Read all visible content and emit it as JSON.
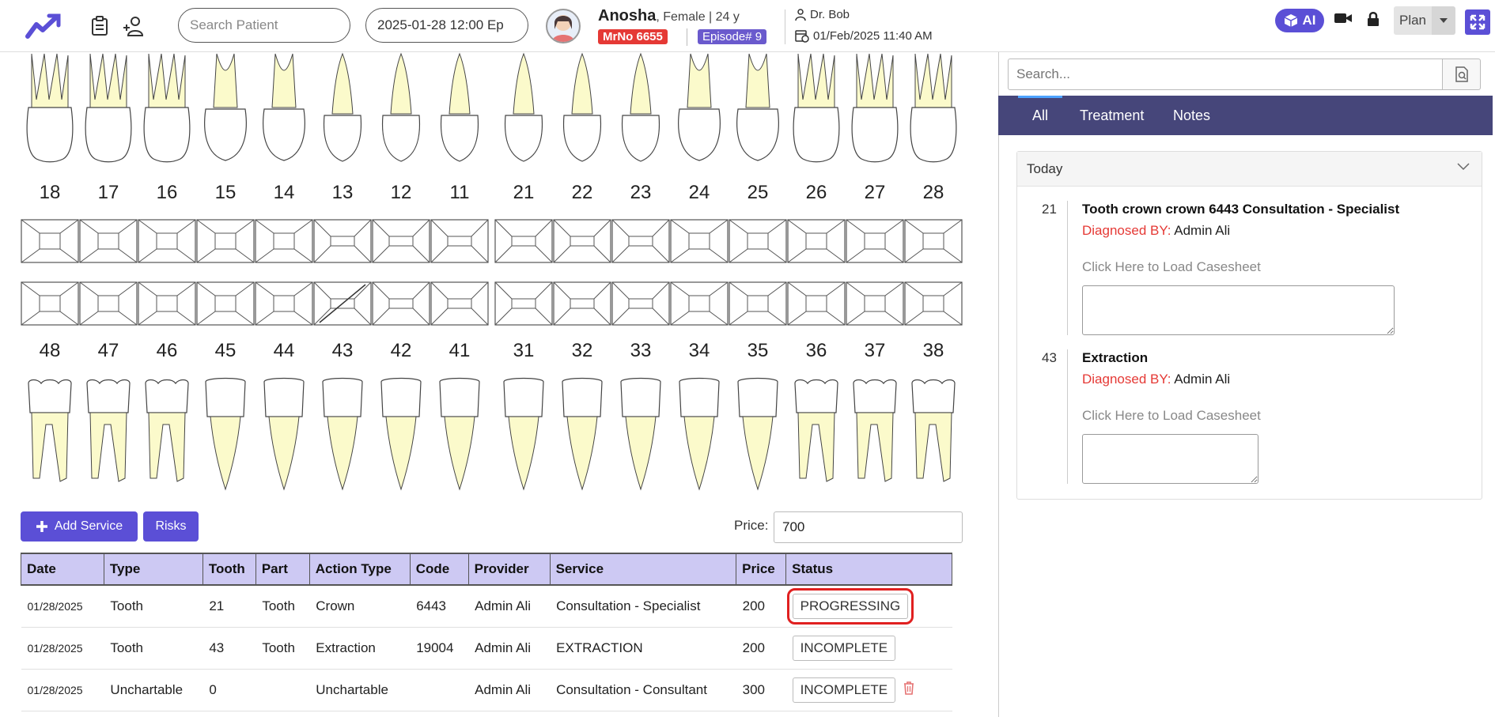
{
  "topbar": {
    "search_placeholder": "Search Patient",
    "episode_date": "2025-01-28 12:00 Ep",
    "patient_name": "Anosha",
    "patient_info": ", Female | 24 y",
    "mrno": "MrNo 6655",
    "episode": "Episode# 9",
    "doctor": "Dr. Bob",
    "datetime": "01/Feb/2025 11:40 AM",
    "ai_label": "AI",
    "plan_label": "Plan"
  },
  "chart": {
    "upper_numbers": [
      "18",
      "17",
      "16",
      "15",
      "14",
      "13",
      "12",
      "11",
      "21",
      "22",
      "23",
      "24",
      "25",
      "26",
      "27",
      "28"
    ],
    "lower_numbers": [
      "48",
      "47",
      "46",
      "45",
      "44",
      "43",
      "42",
      "41",
      "31",
      "32",
      "33",
      "34",
      "35",
      "36",
      "37",
      "38"
    ]
  },
  "actions": {
    "add_service": "Add Service",
    "risks": "Risks",
    "price_label": "Price:",
    "price_value": "700"
  },
  "table": {
    "headers": [
      "Date",
      "Type",
      "Tooth",
      "Part",
      "Action Type",
      "Code",
      "Provider",
      "Service",
      "Price",
      "Status"
    ],
    "rows": [
      {
        "date": "01/28/2025",
        "type": "Tooth",
        "tooth": "21",
        "part": "Tooth",
        "action": "Crown",
        "code": "6443",
        "provider": "Admin Ali",
        "service": "Consultation - Specialist",
        "price": "200",
        "status": "PROGRESSING"
      },
      {
        "date": "01/28/2025",
        "type": "Tooth",
        "tooth": "43",
        "part": "Tooth",
        "action": "Extraction",
        "code": "19004",
        "provider": "Admin Ali",
        "service": "EXTRACTION",
        "price": "200",
        "status": "INCOMPLETE"
      },
      {
        "date": "01/28/2025",
        "type": "Unchartable",
        "tooth": "0",
        "part": "",
        "action": "Unchartable",
        "code": "",
        "provider": "Admin Ali",
        "service": "Consultation - Consultant",
        "price": "300",
        "status": "INCOMPLETE"
      }
    ]
  },
  "right_panel": {
    "search_placeholder": "Search...",
    "tabs": [
      "All",
      "Treatment",
      "Notes"
    ],
    "section_title": "Today",
    "entries": [
      {
        "num": "21",
        "title": "Tooth crown crown 6443 Consultation - Specialist",
        "diag_label": "Diagnosed BY:",
        "diag_value": " Admin Ali",
        "link": "Click Here to Load Casesheet"
      },
      {
        "num": "43",
        "title": "Extraction",
        "diag_label": "Diagnosed BY:",
        "diag_value": " Admin Ali",
        "link": "Click Here to Load Casesheet"
      }
    ]
  },
  "colors": {
    "accent": "#5b4fd6",
    "tab_bar": "#46467a",
    "header_row": "#cdc9f3",
    "root_fill": "#fbfacb",
    "danger": "#e53935"
  }
}
